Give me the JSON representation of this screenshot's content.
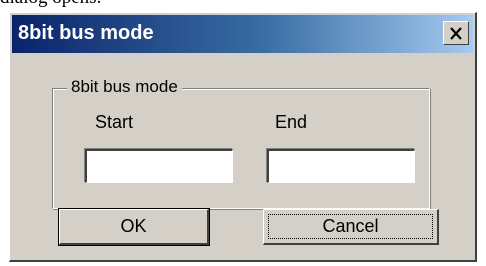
{
  "context": {
    "above_text": "dialog opens."
  },
  "dialog": {
    "title": "8bit bus mode",
    "close_glyph": "✕",
    "group": {
      "label": "8bit bus mode",
      "start_label": "Start",
      "end_label": "End",
      "start_value": "",
      "end_value": ""
    },
    "buttons": {
      "ok_label": "OK",
      "cancel_label": "Cancel"
    }
  },
  "icons": {
    "close": "close-icon"
  },
  "colors": {
    "face": "#d4d0c8",
    "title_start": "#0a246a",
    "title_end": "#a6caf0"
  }
}
